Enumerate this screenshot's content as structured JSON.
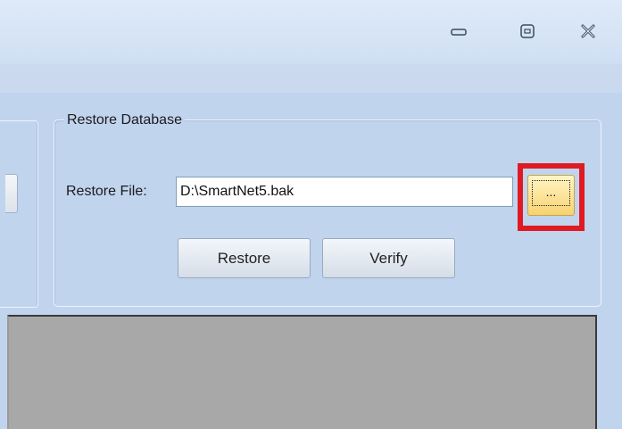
{
  "window": {
    "controls": {
      "minimize_icon": "minimize-icon",
      "maximize_icon": "maximize-icon",
      "close_icon": "close-icon"
    }
  },
  "restore_group": {
    "title": "Restore Database",
    "file_label": "Restore File:",
    "file_value": "D:\\SmartNet5.bak",
    "browse_label": "...",
    "restore_button": "Restore",
    "verify_button": "Verify"
  },
  "colors": {
    "highlight": "#e01a22",
    "browse_button": "#fde6a0",
    "panel": "#c1d4ee",
    "content_area": "#a8a8a8"
  }
}
